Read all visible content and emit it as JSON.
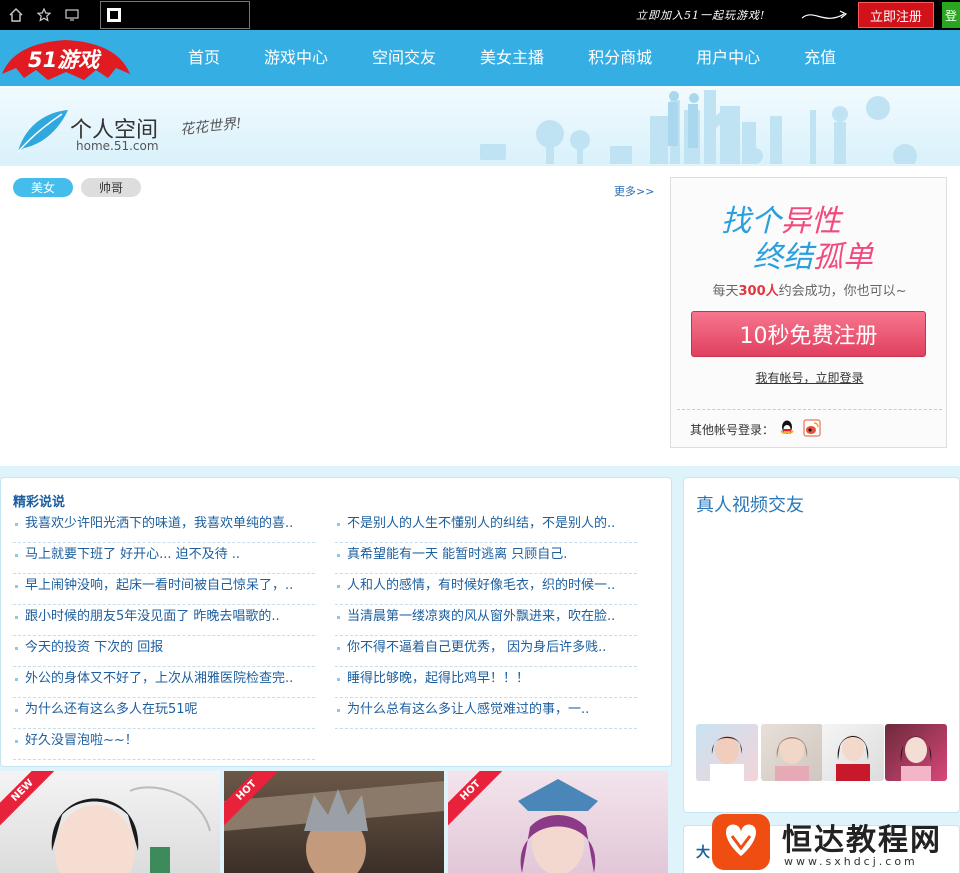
{
  "topbar": {
    "slogan": "立即加入51一起玩游戏!",
    "register_label": "立即注册",
    "green_label": "登"
  },
  "nav": {
    "logo_text": "51游戏",
    "items": [
      "首页",
      "游戏中心",
      "空间交友",
      "美女主播",
      "积分商城",
      "用户中心",
      "充值"
    ]
  },
  "banner": {
    "title": "个人空间",
    "url": "home.51.com",
    "tagline": "花花世界!"
  },
  "tabs": {
    "girls": "美女",
    "boys": "帅哥",
    "more": "更多>>"
  },
  "register_box": {
    "line1_a": "找个",
    "line1_b": "异性",
    "line2_a": "终结",
    "line2_b": "孤单",
    "sub_pre": "每天",
    "sub_num": "300人",
    "sub_post": "约会成功，你也可以~",
    "button": "10秒免费注册",
    "login": "我有帐号，立即登录",
    "other": "其他帐号登录："
  },
  "talk": {
    "title": "精彩说说",
    "left": [
      "我喜欢少许阳光洒下的味道，我喜欢单纯的喜..",
      "马上就要下班了 好开心... 迫不及待 ..",
      "早上闹钟没响，起床一看时间被自己惊呆了，..",
      "跟小时候的朋友5年没见面了 昨晚去唱歌的..",
      "今天的投资  下次的 回报",
      "外公的身体又不好了，上次从湘雅医院检查完..",
      "为什么还有这么多人在玩51呢",
      "好久没冒泡啦~~！"
    ],
    "right": [
      "不是别人的人生不懂别人的纠结，不是别人的..",
      "真希望能有一天 能暂时逃离 只顾自己.",
      "人和人的感情，有时候好像毛衣，织的时候一..",
      "当清晨第一缕凉爽的风从窗外飘进来，吹在脸..",
      "你不得不逼着自己更优秀， 因为身后许多贱..",
      "睡得比够晚，起得比鸡早！！！",
      " 为什么总有这么多让人感觉难过的事，一.."
    ]
  },
  "video": {
    "title": "真人视频交友"
  },
  "bottom_right": {
    "title": "大"
  },
  "games": {
    "ribbons": [
      "NEW",
      "HOT",
      "HOT"
    ]
  },
  "watermark": {
    "name": "恒达教程网",
    "url": "www.sxhdcj.com"
  },
  "colors": {
    "nav": "#35aee4",
    "accent_red": "#d1121b",
    "link": "#1c5e9e"
  }
}
